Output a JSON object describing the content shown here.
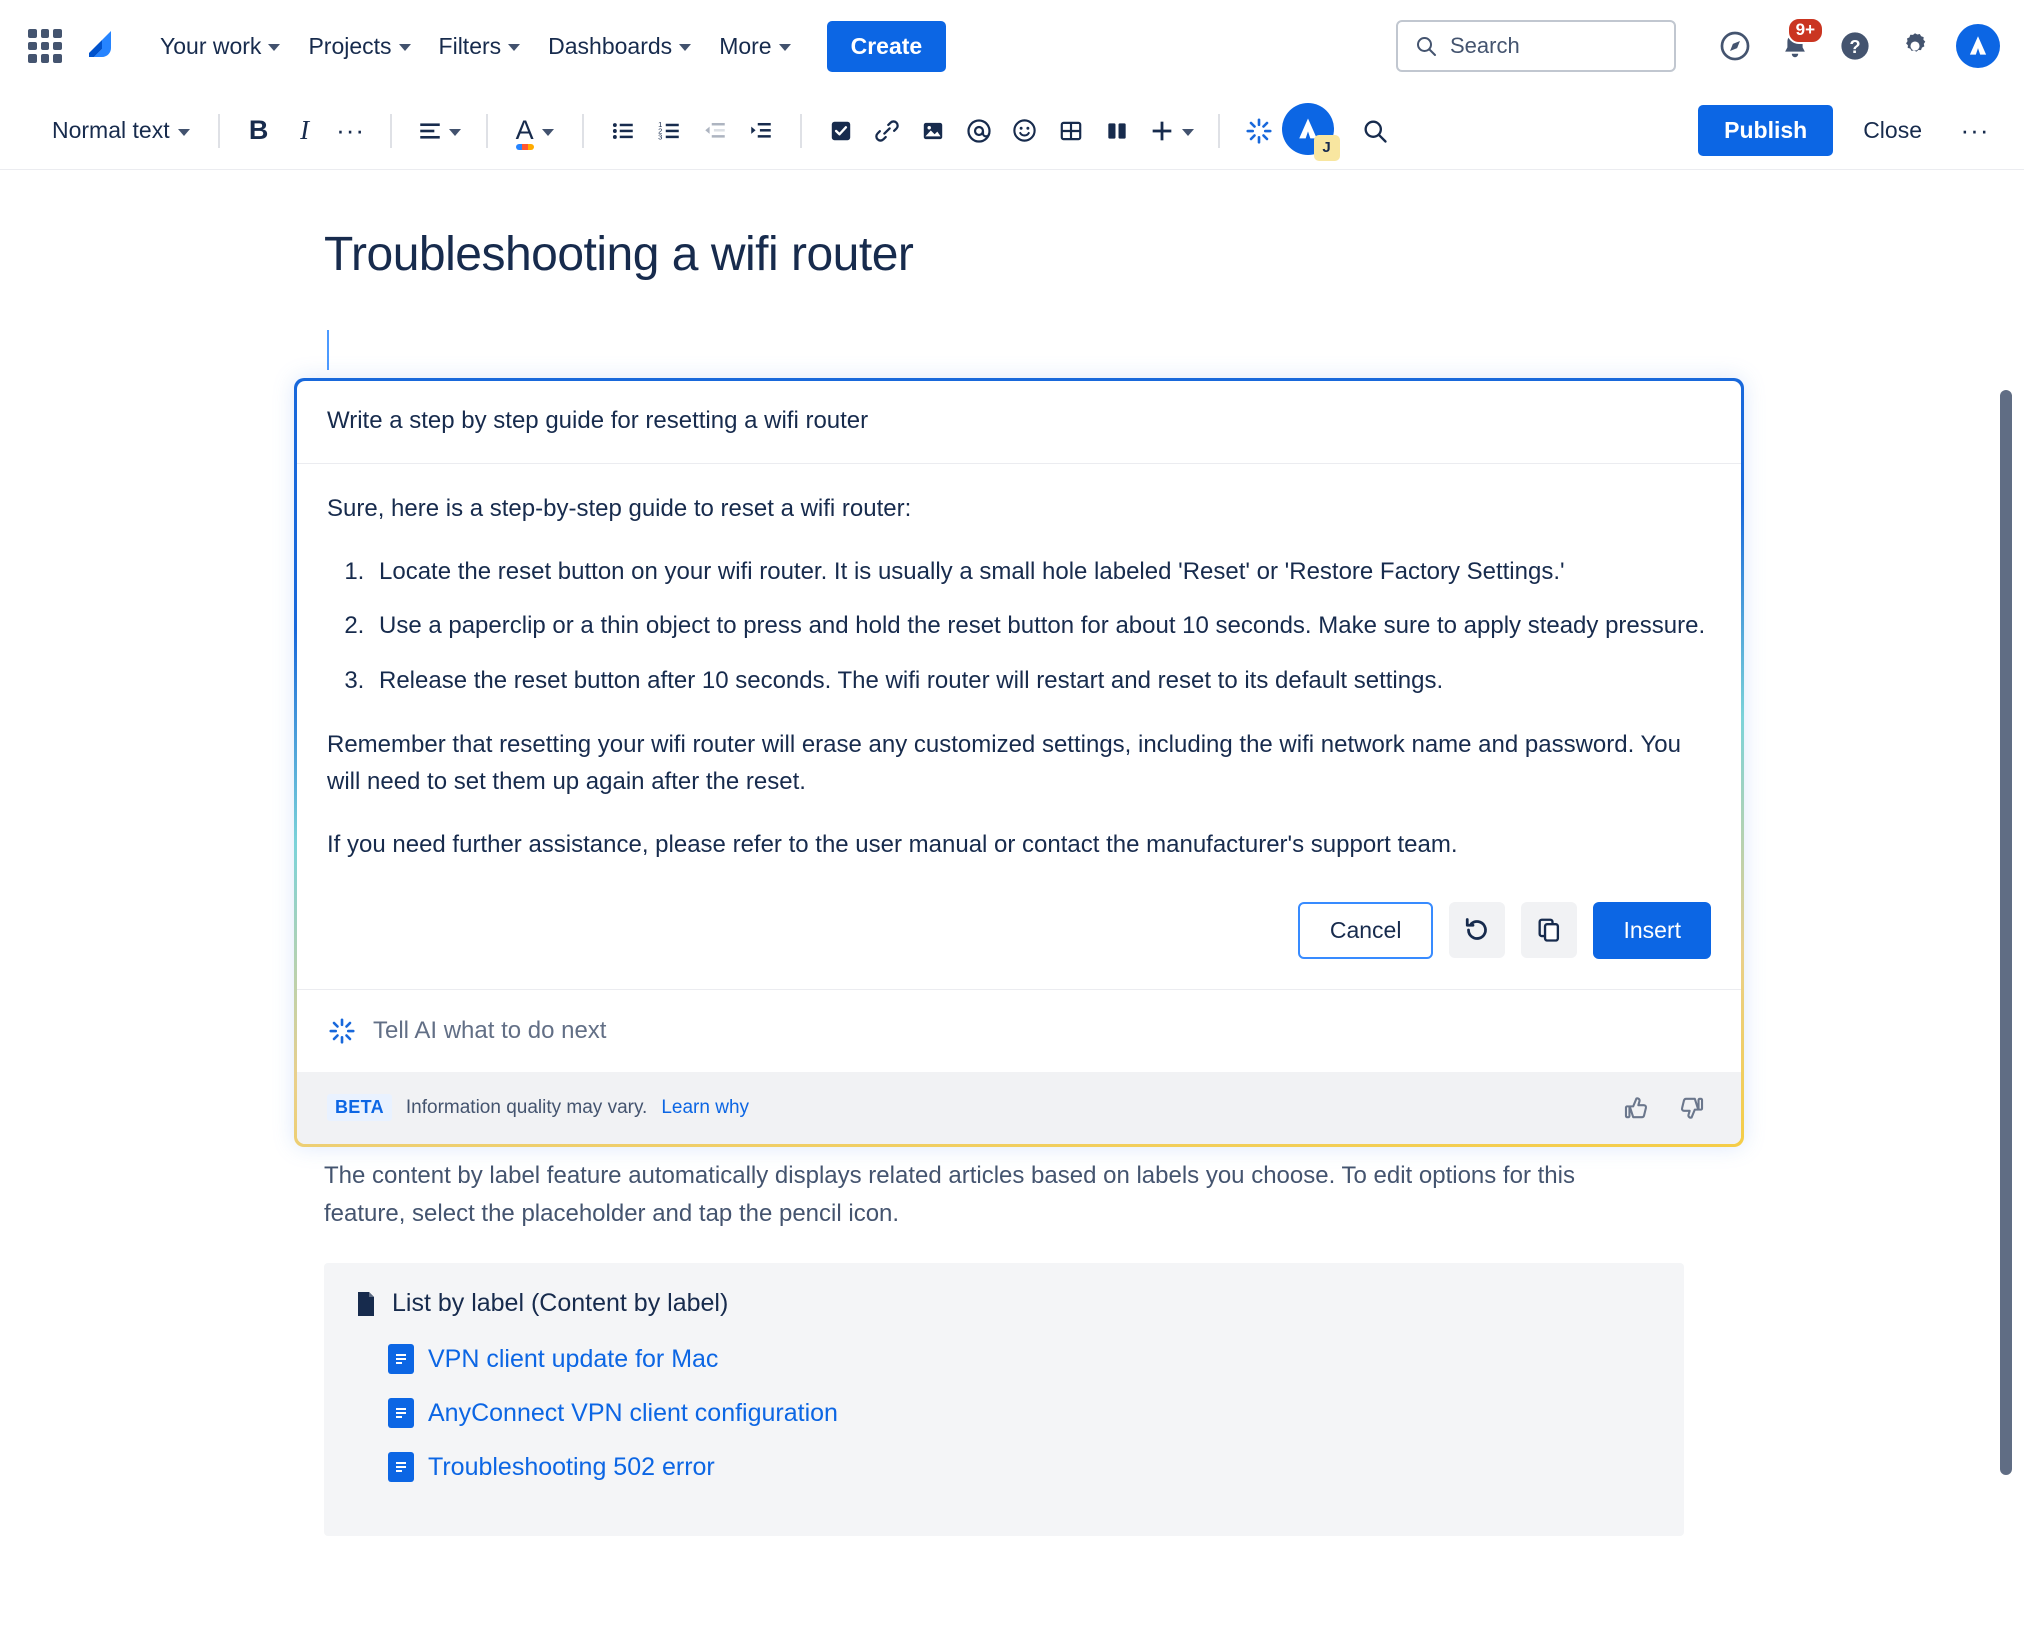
{
  "topnav": {
    "app_switcher": "app-switcher",
    "product": "Jira",
    "items": [
      {
        "label": "Your work",
        "has_chevron": true
      },
      {
        "label": "Projects",
        "has_chevron": true
      },
      {
        "label": "Filters",
        "has_chevron": true
      },
      {
        "label": "Dashboards",
        "has_chevron": true
      },
      {
        "label": "More",
        "has_chevron": true
      }
    ],
    "create_label": "Create",
    "search_placeholder": "Search",
    "notifications_badge": "9+",
    "icons": [
      "compass-icon",
      "notifications-bell-icon",
      "help-icon",
      "settings-gear-icon",
      "profile-avatar"
    ]
  },
  "toolbar": {
    "text_style": "Normal text",
    "bold": "B",
    "italic": "I",
    "more_formatting": "···",
    "align": "align-icon",
    "text_color": "A",
    "bullet_list": "bullet-list-icon",
    "numbered_list": "numbered-list-icon",
    "outdent": "outdent-icon",
    "indent": "indent-icon",
    "task_list": "task-list-icon",
    "link": "link-icon",
    "image": "image-icon",
    "mention": "@",
    "emoji": "emoji-icon",
    "table": "table-icon",
    "layout": "layout-icon",
    "insert_more": "+",
    "ai_label": "Atlassian Intelligence",
    "ai_avatar_initial": "J",
    "find_replace": "search-icon",
    "publish_label": "Publish",
    "close_label": "Close",
    "overflow_label": "···"
  },
  "page": {
    "title": "Troubleshooting a wifi router"
  },
  "ai_panel": {
    "prompt": "Write a step by step guide for resetting a wifi router",
    "intro": "Sure, here is a step-by-step guide to reset a wifi router:",
    "steps": [
      "Locate the reset button on your wifi router. It is usually a small hole labeled 'Reset' or 'Restore Factory Settings.'",
      "Use a paperclip or a thin object to press and hold the reset button for about 10 seconds. Make sure to apply steady pressure.",
      "Release the reset button after 10 seconds. The wifi router will restart and reset to its default settings."
    ],
    "note": "Remember that resetting your wifi router will erase any customized settings, including the wifi network name and password. You will need to set them up again after the reset.",
    "closing": "If you need further assistance, please refer to the user manual or contact the manufacturer's support team.",
    "actions": {
      "cancel": "Cancel",
      "retry": "retry-icon",
      "copy": "copy-icon",
      "insert": "Insert"
    },
    "next_placeholder": "Tell AI what to do next",
    "footer": {
      "beta": "BETA",
      "message": "Information quality may vary.",
      "learn_link": "Learn why",
      "thumbs_up": "thumbs-up-icon",
      "thumbs_down": "thumbs-down-icon"
    },
    "border_colors": {
      "top": "#1868DB",
      "middle": "#7BD3D9",
      "bottom": "#F5CD47"
    }
  },
  "lower_content": {
    "paragraph": "The content by label feature automatically displays related articles based on labels you choose. To edit options for this feature, select the placeholder and tap the pencil icon.",
    "macro_title": "List by label (Content by label)",
    "links": [
      "VPN client update for Mac",
      "AnyConnect VPN client configuration",
      "Troubleshooting 502 error"
    ]
  },
  "colors": {
    "brand_blue": "#0C66E4",
    "text": "#172B4D",
    "subtle_text": "#44546F",
    "badge_red": "#CA3521"
  }
}
